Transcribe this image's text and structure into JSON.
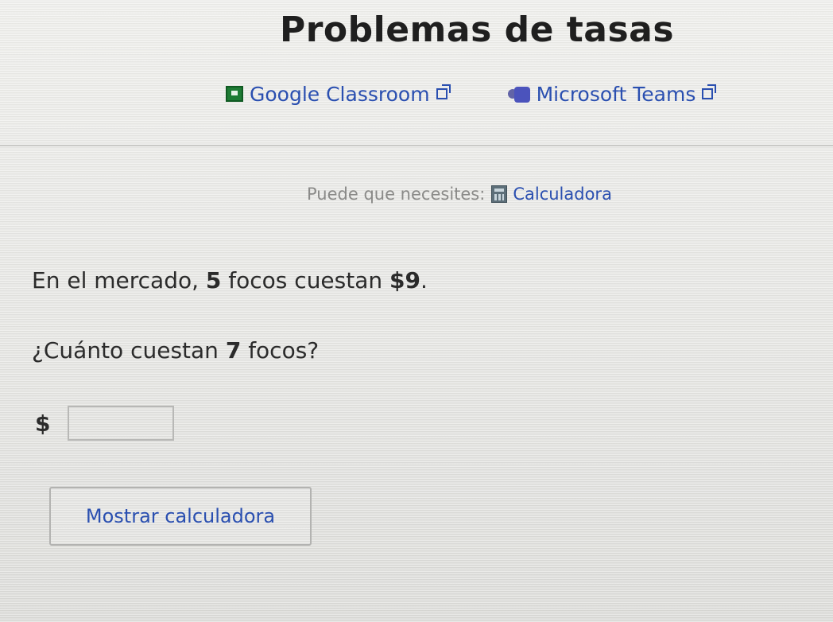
{
  "page": {
    "title": "Problemas de tasas"
  },
  "share": {
    "google_classroom_label": "Google Classroom",
    "microsoft_teams_label": "Microsoft Teams"
  },
  "tools": {
    "hint_label": "Puede que necesites:",
    "calculator_label": "Calculadora"
  },
  "problem": {
    "prompt_prefix": "En el mercado, ",
    "item_count": "5",
    "prompt_middle": " focos cuestan ",
    "price": "$9",
    "prompt_suffix": ".",
    "question_prefix": "¿Cuánto cuestan ",
    "question_count": "7",
    "question_suffix": " focos?"
  },
  "answer": {
    "currency_symbol": "$",
    "value": ""
  },
  "actions": {
    "show_calculator_label": "Mostrar calculadora"
  },
  "colors": {
    "link": "#2a4fb0",
    "text": "#2b2b2b",
    "muted": "#8a8a88",
    "classroom_green": "#1e7b34",
    "teams_purple": "#4b53bc"
  }
}
